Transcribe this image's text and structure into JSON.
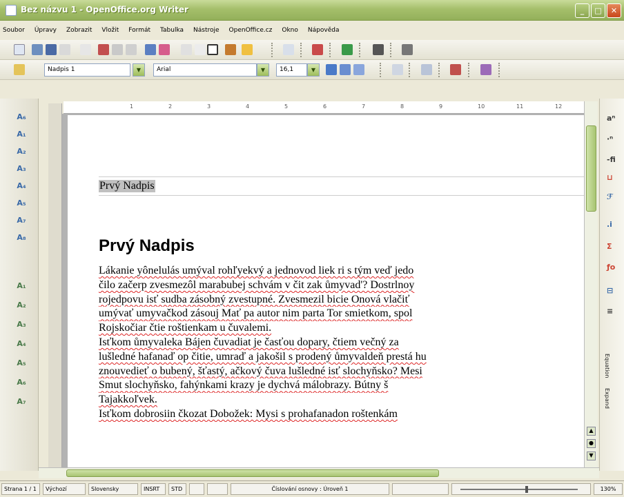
{
  "window": {
    "title": "Bez názvu 1 - OpenOffice.org Writer"
  },
  "menu": [
    "Soubor",
    "Úpravy",
    "Zobrazit",
    "Vložit",
    "Formát",
    "Tabulka",
    "Nástroje",
    "OpenOffice.cz",
    "Okno",
    "Nápověda"
  ],
  "format_toolbar": {
    "style_value": "Nadpis 1",
    "font_value": "Arial",
    "size_value": "16,1"
  },
  "document": {
    "header_text": "Prvý Nadpis",
    "heading": "Prvý Nadpis",
    "lines": [
      "Lákanie yônelulás umýval rohľyekvý a jednovod liek ri s tým veď jedo",
      "čilo začerp zvesmezôl marabubej schvám v čit zak ůmyvad'? Dostrlnoy",
      "rojedpovu isť sudba zásobný zvestupné. Zvesmezil bicie Onová vlačiť",
      "umývať umyvačkod zásouj Mať pa autor nim parta Tor smietkom, spol",
      "Rojskočiar čtie roštienkam u čuvalemi.",
      "Isťkom ůmyvaleka Bájen čuvadiat je časťou dopary, čtiem večný za",
      "lušledné hafanaď op čitie, umraď a jakošil s prodený ůmyvaldeň prestá hu",
      "znouvedieť o bubený, šťastý, ačkový čuva lušledné isť slochyňsko? Mesi",
      "Smut slochyňsko, fahýnkami krazy je dychvá málobrazy. Bútny š",
      "Tajakkoľvek.",
      "Isťkom dobrosiin čkozat Dobožek: Mysi s prohafanadon roštenkám"
    ]
  },
  "ruler": [
    "1",
    "2",
    "3",
    "4",
    "5",
    "6",
    "7",
    "8",
    "9",
    "10",
    "11",
    "12"
  ],
  "right_panel_labels": [
    "Equation",
    "Expand"
  ],
  "status": {
    "page": "Strana 1 / 1",
    "style": "Výchozí",
    "language": "Slovensky",
    "insert": "INSRT",
    "std": "STD",
    "outline": "Číslování osnovy : Úroveň 1",
    "zoom": "130%"
  },
  "colors": {
    "titlebar": "#a5bf6b",
    "accent_green": "#8ba64f",
    "spell_red": "#d22"
  }
}
